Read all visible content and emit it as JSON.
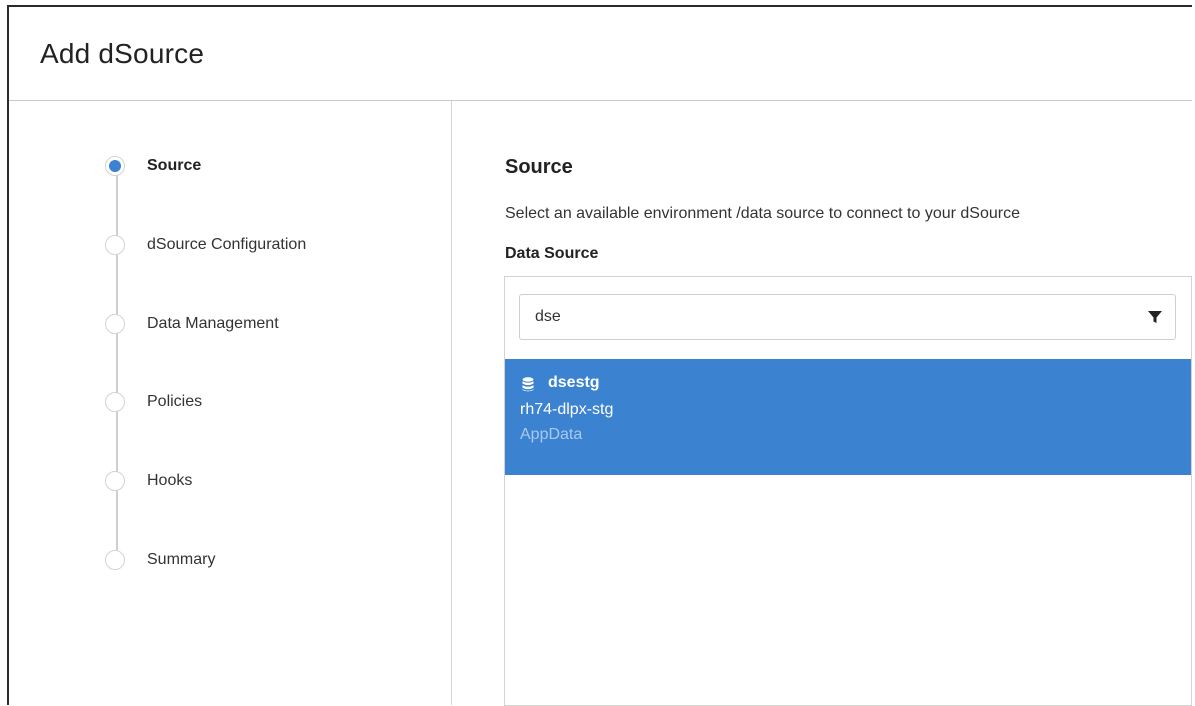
{
  "dialog": {
    "title": "Add dSource"
  },
  "steps": [
    {
      "label": "Source",
      "active": true
    },
    {
      "label": "dSource Configuration",
      "active": false
    },
    {
      "label": "Data Management",
      "active": false
    },
    {
      "label": "Policies",
      "active": false
    },
    {
      "label": "Hooks",
      "active": false
    },
    {
      "label": "Summary",
      "active": false
    }
  ],
  "source": {
    "title": "Source",
    "description": "Select an available environment /data source to connect to your dSource",
    "data_source_label": "Data Source",
    "search": {
      "value": "dse",
      "placeholder": ""
    },
    "items": [
      {
        "name": "dsestg",
        "environment": "rh74-dlpx-stg",
        "type": "AppData",
        "icon": "database-icon",
        "selected": true
      }
    ]
  },
  "colors": {
    "accent": "#3b82d0",
    "muted_text": "#a9c9ee",
    "border": "#d3d3d3"
  }
}
